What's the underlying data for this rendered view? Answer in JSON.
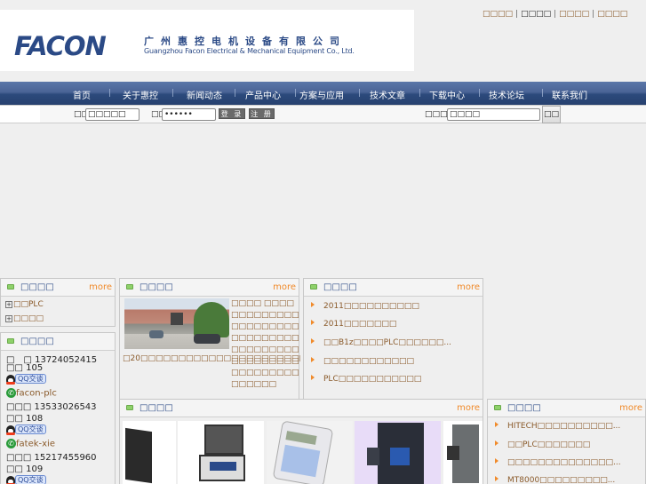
{
  "header": {
    "logo_word": "FACON",
    "logo_cn": "广州惠控电机设备有限公司",
    "logo_en": "Guangzhou Facon Electrical & Mechanical Equipment Co., Ltd.",
    "top_links": [
      "□□□□",
      "□□□□",
      "□□□□",
      "□□□□"
    ]
  },
  "nav": {
    "items": [
      "首页",
      "关于惠控",
      "新闻动态",
      "产品中心",
      "方案与应用",
      "技术文章",
      "下载中心",
      "技术论坛",
      "联系我们"
    ]
  },
  "login": {
    "username_label": "□□:",
    "username_value": "□□□□□",
    "password_label": "□□:",
    "password_value": "••••••",
    "login_button": "登 录",
    "register_button": "注 册",
    "search_label": "□□□□□",
    "search_value": "□□□□",
    "search_button": "□□"
  },
  "panels": {
    "categories": {
      "title": "□□□□",
      "more": "more",
      "items": [
        "□□PLC",
        "□□□□"
      ]
    },
    "contact": {
      "title": "□□□□",
      "entries": [
        {
          "name": null,
          "phone_label": "□　□",
          "phone": "13724052415",
          "ext_label": "□□",
          "ext": "105",
          "qq_label": "QQ交谈"
        },
        {
          "name": "facon-plc",
          "phone_label": "□□□",
          "phone": "13533026543",
          "ext_label": "□□",
          "ext": "108",
          "qq_label": "QQ交谈"
        },
        {
          "name": "fatek-xie",
          "phone_label": "□□□",
          "phone": "15217455960",
          "ext_label": "□□",
          "ext": "109",
          "qq_label": "QQ交谈"
        }
      ]
    },
    "about": {
      "title": "□□□□",
      "more": "more",
      "text": "□□□□ □□□□□□□□□□□□□□□□□□□□□□□□□□□□□□□□□□□□□□□□□□□□□□□□□□□□□□□□□□□□□□□□",
      "text_more": "□20□□□□□□□□□□□□□□□□□□□□□□□□□□□□□□□□□□□□....."
    },
    "news": {
      "title": "□□□□",
      "more": "more",
      "items": [
        "2011□□□□□□□□□□",
        "2011□□□□□□□",
        "□□B1z□□□□PLC□□□□□□...",
        "□□□□□□□□□□□□",
        "PLC□□□□□□□□□□□"
      ]
    },
    "products": {
      "title": "□□□□",
      "more": "more",
      "images": [
        "plc-module",
        "test-case",
        "handheld-programmer",
        "plc-unit",
        "plc-side-module"
      ]
    },
    "tech": {
      "title": "□□□□",
      "more": "more",
      "items": [
        "HITECH□□□□□□□□□□...",
        "□□PLC□□□□□□□",
        "□□□□□□□□□□□□□□...",
        "MT8000□□□□□□□□□..."
      ]
    }
  }
}
